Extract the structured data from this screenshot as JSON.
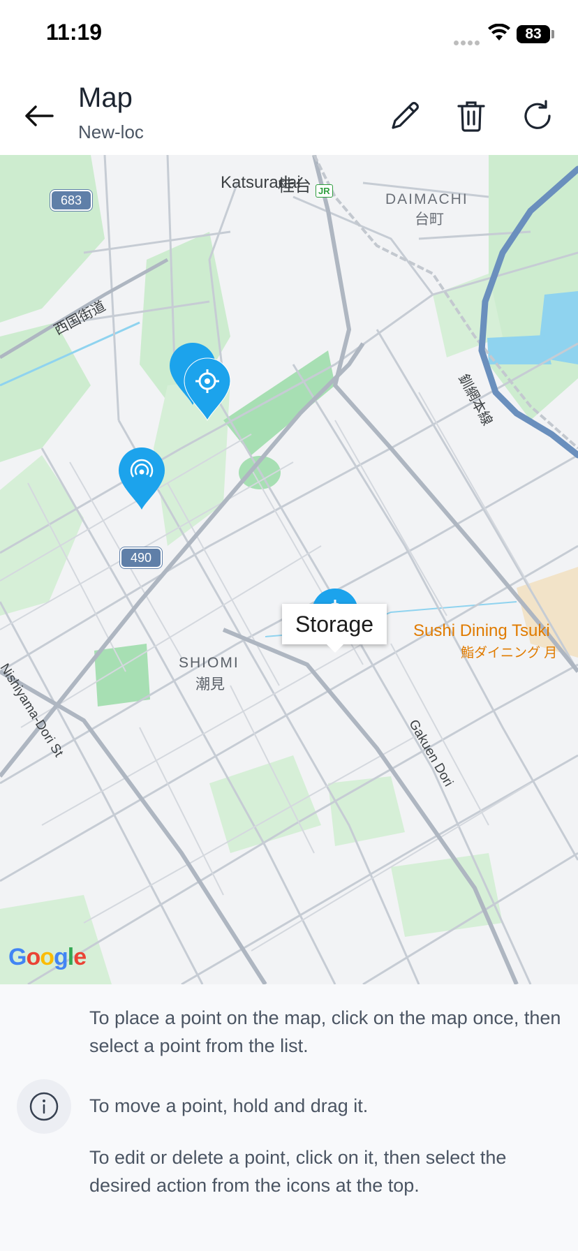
{
  "status_bar": {
    "time": "11:19",
    "battery": "83"
  },
  "header": {
    "title": "Map",
    "subtitle": "New-loc"
  },
  "map": {
    "labels": {
      "katsuradai": "Katsuradai",
      "katsuradai_jp": "桂台",
      "daimachi": "DAIMACHI",
      "daimachi_jp": "台町",
      "saikoku": "西国街道",
      "senmo": "釧網本線",
      "shiomi": "SHIOMI",
      "shiomi_jp": "潮見",
      "nishiyama": "Nishiyama-Dori St",
      "gakuen": "Gakuen Dori",
      "sushi": "Sushi Dining Tsuki",
      "sushi_jp": "鮨ダイニング 月",
      "jr": "JR"
    },
    "route_shields": [
      "683",
      "490"
    ],
    "tooltip": "Storage",
    "attribution": "Google",
    "colors": {
      "marker": "#1ca3ec",
      "park": "#bfe6c9",
      "water": "#9fd9ef",
      "river": "#6a8fbd",
      "road": "#c6ccd4"
    }
  },
  "info": {
    "line1": "To place a point on the map, click on the map once, then select a point from the list.",
    "line2": "To move a point, hold and drag it.",
    "line3": "To edit or delete a point, click on it, then select the desired action from the icons at the top."
  }
}
